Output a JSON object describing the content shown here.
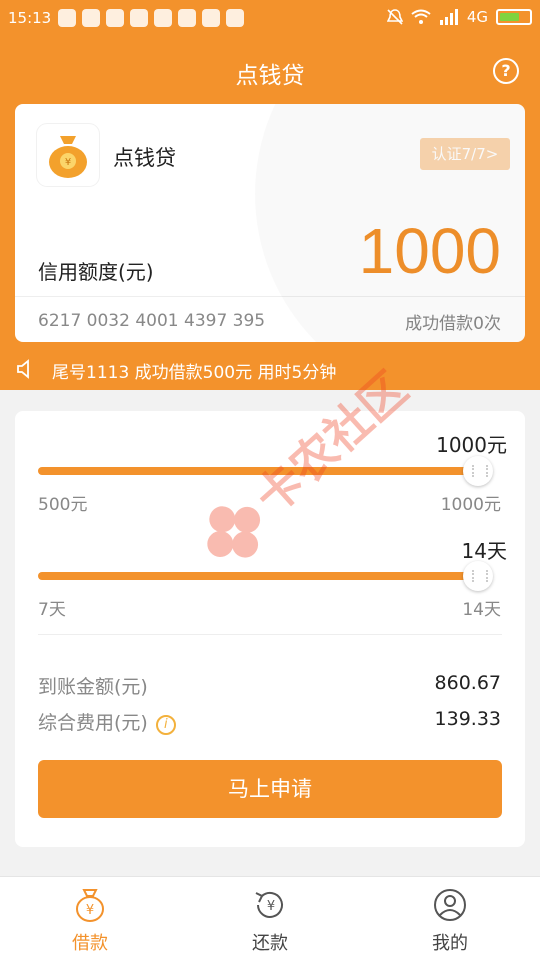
{
  "status_bar": {
    "time": "15:13",
    "network": "4G"
  },
  "header": {
    "title": "点钱贷"
  },
  "card": {
    "app_name": "点钱贷",
    "cert_badge": "认证7/7>",
    "limit_label": "信用额度(元)",
    "limit_value": "1000",
    "card_number": "6217 0032 4001 4397 395",
    "borrow_count": "成功借款0次"
  },
  "notice": {
    "text": "尾号1113 成功借款500元 用时5分钟"
  },
  "amount_slider": {
    "value": "1000元",
    "min": "500元",
    "max": "1000元",
    "level": 1.0
  },
  "term_slider": {
    "value": "14天",
    "min": "7天",
    "max": "14天",
    "level": 1.0
  },
  "summary": {
    "received_label": "到账金额(元)",
    "received_value": "860.67",
    "fee_label": "综合费用(元)",
    "fee_value": "139.33"
  },
  "apply_button": "马上申请",
  "tabs": [
    {
      "label": "借款",
      "icon": "moneybag-icon",
      "active": true
    },
    {
      "label": "还款",
      "icon": "repay-icon",
      "active": false
    },
    {
      "label": "我的",
      "icon": "user-icon",
      "active": false
    }
  ],
  "watermark": "卡农社区",
  "colors": {
    "primary": "#f3922c",
    "badge": "#fbd7b0",
    "watermark": "#f04020"
  }
}
